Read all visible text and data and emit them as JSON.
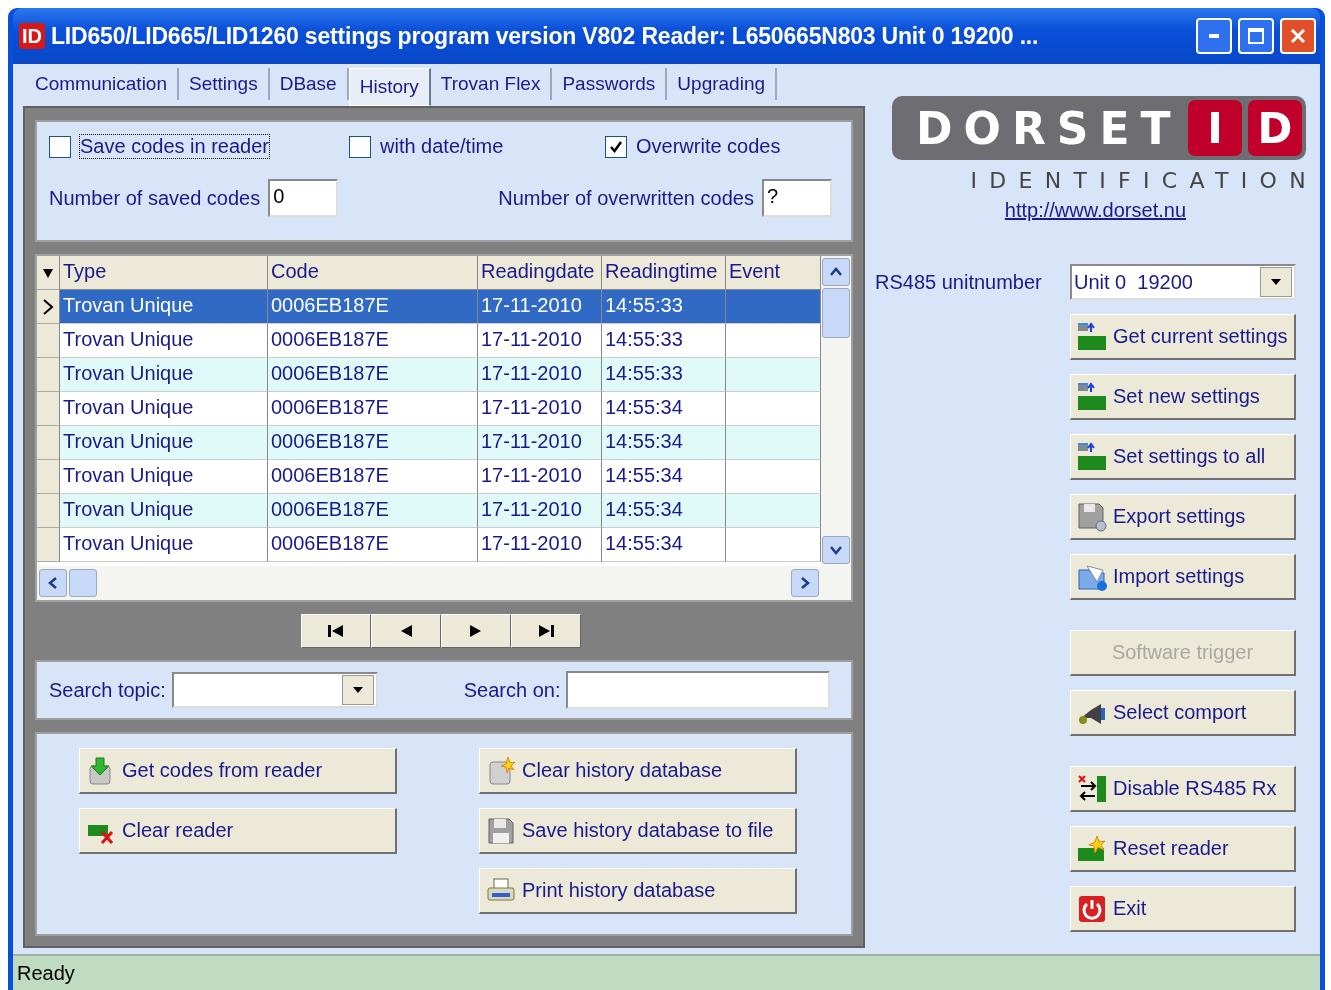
{
  "window": {
    "app_icon_text": "ID",
    "title": "LID650/LID665/LID1260 settings program version V802  Reader: L650665N803 Unit 0 19200 ..."
  },
  "tabs": [
    {
      "label": "Communication",
      "selected": false
    },
    {
      "label": "Settings",
      "selected": false
    },
    {
      "label": "DBase",
      "selected": false
    },
    {
      "label": "History",
      "selected": true
    },
    {
      "label": "Trovan Flex",
      "selected": false
    },
    {
      "label": "Passwords",
      "selected": false
    },
    {
      "label": "Upgrading",
      "selected": false
    }
  ],
  "options": {
    "checkboxes": [
      {
        "label": "Save codes in reader",
        "checked": false,
        "focused": true
      },
      {
        "label": "with date/time",
        "checked": false,
        "focused": false
      },
      {
        "label": "Overwrite codes",
        "checked": true,
        "focused": false
      }
    ],
    "fields": [
      {
        "label": "Number of saved codes",
        "value": "0"
      },
      {
        "label": "Number of overwritten codes",
        "value": "?"
      }
    ]
  },
  "table": {
    "columns": [
      "Type",
      "Code",
      "Readingdate",
      "Readingtime",
      "Event"
    ],
    "rows": [
      {
        "selected": true,
        "cells": [
          "Trovan Unique",
          "0006EB187E",
          "17-11-2010",
          "14:55:33"
        ]
      },
      {
        "selected": false,
        "cells": [
          "Trovan Unique",
          "0006EB187E",
          "17-11-2010",
          "14:55:33"
        ]
      },
      {
        "selected": false,
        "cells": [
          "Trovan Unique",
          "0006EB187E",
          "17-11-2010",
          "14:55:33"
        ]
      },
      {
        "selected": false,
        "cells": [
          "Trovan Unique",
          "0006EB187E",
          "17-11-2010",
          "14:55:34"
        ]
      },
      {
        "selected": false,
        "cells": [
          "Trovan Unique",
          "0006EB187E",
          "17-11-2010",
          "14:55:34"
        ]
      },
      {
        "selected": false,
        "cells": [
          "Trovan Unique",
          "0006EB187E",
          "17-11-2010",
          "14:55:34"
        ]
      },
      {
        "selected": false,
        "cells": [
          "Trovan Unique",
          "0006EB187E",
          "17-11-2010",
          "14:55:34"
        ]
      },
      {
        "selected": false,
        "cells": [
          "Trovan Unique",
          "0006EB187E",
          "17-11-2010",
          "14:55:34"
        ]
      }
    ]
  },
  "search": {
    "topic_label": "Search topic:",
    "on_label": "Search on:"
  },
  "history_buttons": [
    {
      "label": "Get codes from reader"
    },
    {
      "label": "Clear history database"
    },
    {
      "label": "Clear reader"
    },
    {
      "label": "Save history database to file"
    },
    {
      "label": "Print history database"
    }
  ],
  "logo": {
    "word": "DORSET",
    "letters": [
      "I",
      "D"
    ],
    "tagline": "IDENTIFICATION"
  },
  "link": "http://www.dorset.nu",
  "unit": {
    "label": "RS485 unitnumber",
    "value": "Unit 0  19200"
  },
  "side_buttons": [
    {
      "label": "Get current settings",
      "disabled": false
    },
    {
      "label": "Set new settings",
      "disabled": false
    },
    {
      "label": "Set settings to all",
      "disabled": false
    },
    {
      "label": "Export settings",
      "disabled": false
    },
    {
      "label": "Import settings",
      "disabled": false
    },
    {
      "label": "Software trigger",
      "disabled": true
    },
    {
      "label": "Select comport",
      "disabled": false
    },
    {
      "label": "Disable RS485 Rx",
      "disabled": false
    },
    {
      "label": "Reset reader",
      "disabled": false
    },
    {
      "label": "Exit",
      "disabled": false
    }
  ],
  "status_bar": "Ready"
}
